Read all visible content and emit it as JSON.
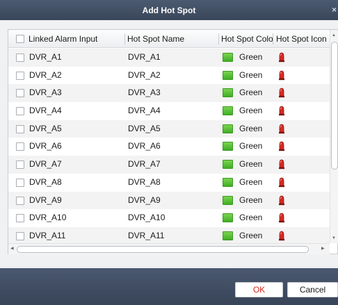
{
  "dialog": {
    "title": "Add Hot Spot",
    "close_glyph": "×"
  },
  "table": {
    "columns": {
      "linked_alarm_input": "Linked Alarm Input",
      "hot_spot_name": "Hot Spot Name",
      "hot_spot_color": "Hot Spot Color",
      "hot_spot_icon": "Hot Spot Icon"
    },
    "rows": [
      {
        "input": "DVR_A1",
        "name": "DVR_A1",
        "color": "Green",
        "icon": "alarm-light-icon"
      },
      {
        "input": "DVR_A2",
        "name": "DVR_A2",
        "color": "Green",
        "icon": "alarm-light-icon"
      },
      {
        "input": "DVR_A3",
        "name": "DVR_A3",
        "color": "Green",
        "icon": "alarm-light-icon"
      },
      {
        "input": "DVR_A4",
        "name": "DVR_A4",
        "color": "Green",
        "icon": "alarm-light-icon"
      },
      {
        "input": "DVR_A5",
        "name": "DVR_A5",
        "color": "Green",
        "icon": "alarm-light-icon"
      },
      {
        "input": "DVR_A6",
        "name": "DVR_A6",
        "color": "Green",
        "icon": "alarm-light-icon"
      },
      {
        "input": "DVR_A7",
        "name": "DVR_A7",
        "color": "Green",
        "icon": "alarm-light-icon"
      },
      {
        "input": "DVR_A8",
        "name": "DVR_A8",
        "color": "Green",
        "icon": "alarm-light-icon"
      },
      {
        "input": "DVR_A9",
        "name": "DVR_A9",
        "color": "Green",
        "icon": "alarm-light-icon"
      },
      {
        "input": "DVR_A10",
        "name": "DVR_A10",
        "color": "Green",
        "icon": "alarm-light-icon"
      },
      {
        "input": "DVR_A11",
        "name": "DVR_A11",
        "color": "Green",
        "icon": "alarm-light-icon"
      }
    ]
  },
  "footer": {
    "ok_label": "OK",
    "cancel_label": "Cancel"
  },
  "colors": {
    "title_bar": "#3f4d62",
    "swatch_green": "#4cbb2c",
    "ok_text": "#d0241c",
    "alarm_red": "#d42a22"
  }
}
